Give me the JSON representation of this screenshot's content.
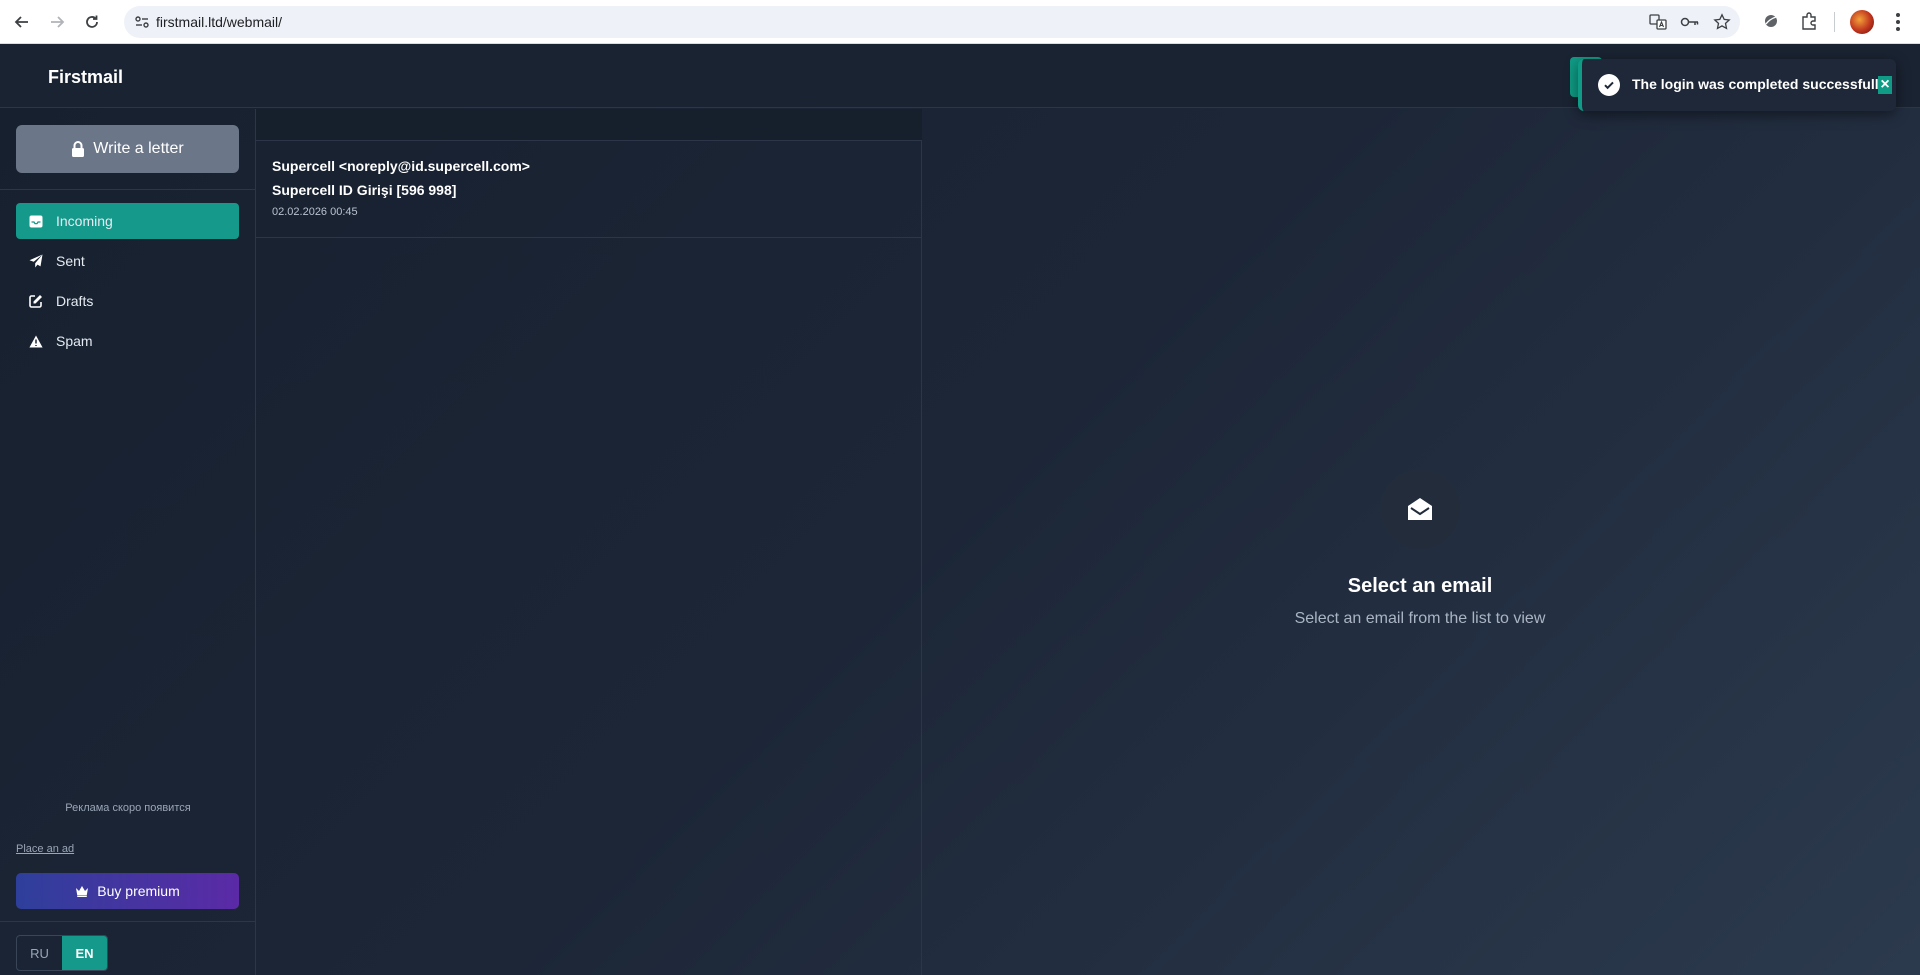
{
  "browser": {
    "url": "firstmail.ltd/webmail/"
  },
  "app": {
    "brand": "Firstmail",
    "toast": {
      "message": "The login was completed successfully",
      "close_symbol": "×"
    }
  },
  "sidebar": {
    "compose_label": "Write a letter",
    "folders": [
      {
        "label": "Incoming",
        "icon": "inbox-icon",
        "active": true
      },
      {
        "label": "Sent",
        "icon": "paper-plane-icon",
        "active": false
      },
      {
        "label": "Drafts",
        "icon": "edit-icon",
        "active": false
      },
      {
        "label": "Spam",
        "icon": "warning-icon",
        "active": false
      }
    ],
    "ad_notice": "Реклама скоро появится",
    "place_ad_label": "Place an ad",
    "premium_label": "Buy premium",
    "languages": [
      {
        "code": "RU",
        "active": false
      },
      {
        "code": "EN",
        "active": true
      }
    ]
  },
  "emails": [
    {
      "from": "Supercell <noreply@id.supercell.com>",
      "subject": "Supercell ID Girişi [596 998]",
      "date": "02.02.2026 00:45"
    }
  ],
  "reader": {
    "empty_title": "Select an email",
    "empty_subtitle": "Select an email from the list to view"
  },
  "colors": {
    "accent": "#14998a",
    "premium_from": "#2e3f9b",
    "premium_to": "#5b2aa6",
    "compose_button": "#6b7688"
  }
}
